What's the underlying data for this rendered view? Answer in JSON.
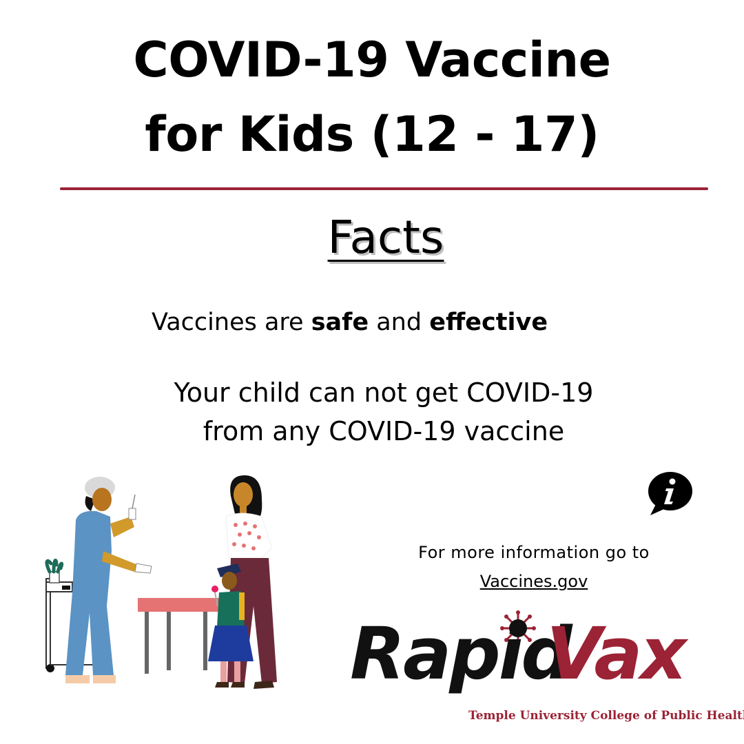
{
  "header": {
    "title_line1": "COVID-19 Vaccine",
    "title_line2": "for Kids (12 - 17)"
  },
  "facts": {
    "heading": "Facts",
    "fact1_prefix": "Vaccines are ",
    "fact1_bold1": "safe",
    "fact1_mid": " and ",
    "fact1_bold2": "effective",
    "fact2_line1": "Your child can not get COVID-19",
    "fact2_line2": "from any COVID-19 vaccine"
  },
  "info": {
    "icon": "info-speech-bubble-icon",
    "text": "For more information go to",
    "link": "Vaccines.gov"
  },
  "logo": {
    "word1": "Rapid",
    "word2": "Vax",
    "subtitle": "Temple University College of Public Health"
  },
  "colors": {
    "accent": "#9b2335",
    "text": "#000000",
    "background": "#ffffff"
  }
}
